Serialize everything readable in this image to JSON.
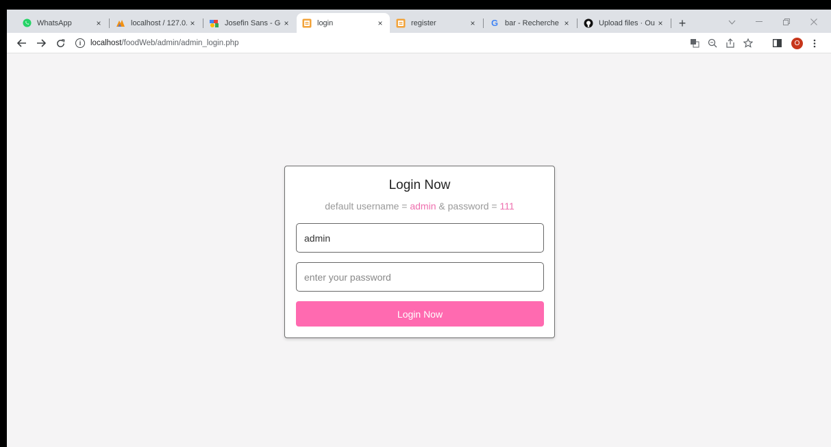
{
  "browser": {
    "tabs": [
      {
        "title": "WhatsApp",
        "icon": "whatsapp-icon",
        "color": "#25d366"
      },
      {
        "title": "localhost / 127.0.",
        "icon": "phpmyadmin-icon",
        "color": "#f29111"
      },
      {
        "title": "Josefin Sans - Go",
        "icon": "google-fonts-icon",
        "color": "#4285f4"
      },
      {
        "title": "login",
        "icon": "page-icon",
        "color": "#f2a33a"
      },
      {
        "title": "register",
        "icon": "page-icon",
        "color": "#f2a33a"
      },
      {
        "title": "bar - Recherche",
        "icon": "google-icon",
        "color": "#4285f4"
      },
      {
        "title": "Upload files · Ou",
        "icon": "github-icon",
        "color": "#000000"
      }
    ],
    "close_glyph": "×",
    "new_tab_glyph": "+",
    "url_host": "localhost",
    "url_path": "/foodWeb/admin/admin_login.php",
    "profile_initial": "O"
  },
  "login": {
    "title": "Login Now",
    "hint_prefix": "default username = ",
    "hint_username": "admin",
    "hint_mid": " & password = ",
    "hint_password": "111",
    "username_value": "admin",
    "password_placeholder": "enter your password",
    "button_label": "Login Now"
  },
  "colors": {
    "accent": "#ff6ab0",
    "accent_text": "#ee6fae",
    "background": "#f5f4f5"
  }
}
